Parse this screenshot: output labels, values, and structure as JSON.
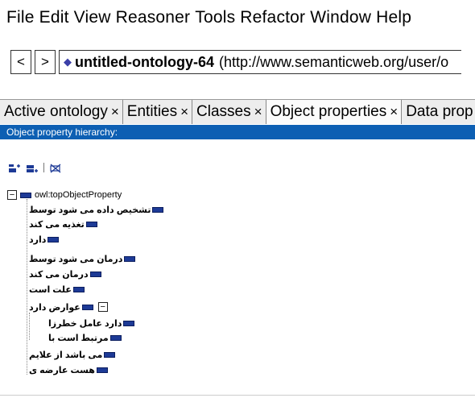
{
  "menu": [
    "File",
    "Edit",
    "View",
    "Reasoner",
    "Tools",
    "Refactor",
    "Window",
    "Help"
  ],
  "nav": {
    "back_label": "<",
    "forward_label": ">",
    "ontology_name": "untitled-ontology-64",
    "ontology_iri": "(http://www.semanticweb.org/user/o"
  },
  "tabs": [
    {
      "label": "Active ontology",
      "close": "×"
    },
    {
      "label": "Entities",
      "close": "×"
    },
    {
      "label": "Classes",
      "close": "×"
    },
    {
      "label": "Object properties",
      "close": "×"
    },
    {
      "label": "Data prop",
      "close": ""
    }
  ],
  "view": {
    "title": "Object property hierarchy:"
  },
  "tree": {
    "root": {
      "label": "owl:topObjectProperty",
      "toggle": "−"
    },
    "children": [
      {
        "label": "تشخیص داده می شود توسط"
      },
      {
        "label": "تغذیه می کند"
      },
      {
        "label": "دارد"
      },
      {
        "label": "درمان می شود توسط"
      },
      {
        "label": "درمان می کند"
      },
      {
        "label": "علت است"
      },
      {
        "label": "عوارض دارد",
        "toggle": "−"
      },
      {
        "label": "دارد عامل خطرزا",
        "level": 2
      },
      {
        "label": "مرتبط است با",
        "level": 2
      },
      {
        "label": "می باشد از علایم"
      },
      {
        "label": "هست عارضه ی"
      }
    ]
  },
  "colors": {
    "accent": "#0d5fb3",
    "property_icon": "#1d3a96"
  }
}
